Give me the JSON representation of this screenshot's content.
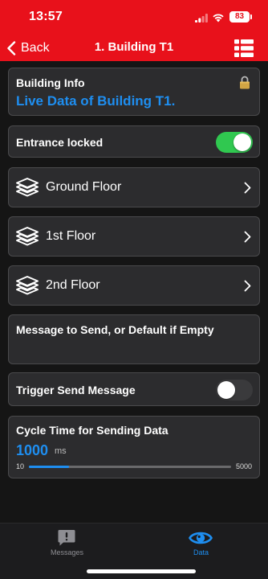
{
  "status_bar": {
    "time": "13:57",
    "battery": "83"
  },
  "nav": {
    "back_label": "Back",
    "title": "1. Building T1"
  },
  "building_info": {
    "label": "Building Info",
    "link_text": "Live Data of Building T1."
  },
  "entrance": {
    "label": "Entrance locked",
    "on": true
  },
  "floors": [
    {
      "label": "Ground Floor"
    },
    {
      "label": "1st Floor"
    },
    {
      "label": "2nd Floor"
    }
  ],
  "message": {
    "placeholder": "Message to Send, or Default if Empty"
  },
  "trigger": {
    "label": "Trigger Send Message",
    "on": false
  },
  "cycle": {
    "label": "Cycle Time for Sending Data",
    "value": "1000",
    "unit": "ms",
    "min": "10",
    "max": "5000"
  },
  "tabs": {
    "messages_label": "Messages",
    "data_label": "Data",
    "active": "Data"
  },
  "colors": {
    "brand_red": "#e8111b",
    "accent_blue": "#1e8ef0",
    "toggle_on": "#30c850",
    "card_bg": "#2c2c2e"
  },
  "icons": {
    "back": "chevron-left-icon",
    "menu": "list-icon",
    "lock": "lock-icon",
    "floor": "layers-icon",
    "chevron": "chevron-right-icon",
    "qr": "qr-code-icon",
    "messages_tab": "message-alert-icon",
    "data_tab": "eye-icon"
  }
}
